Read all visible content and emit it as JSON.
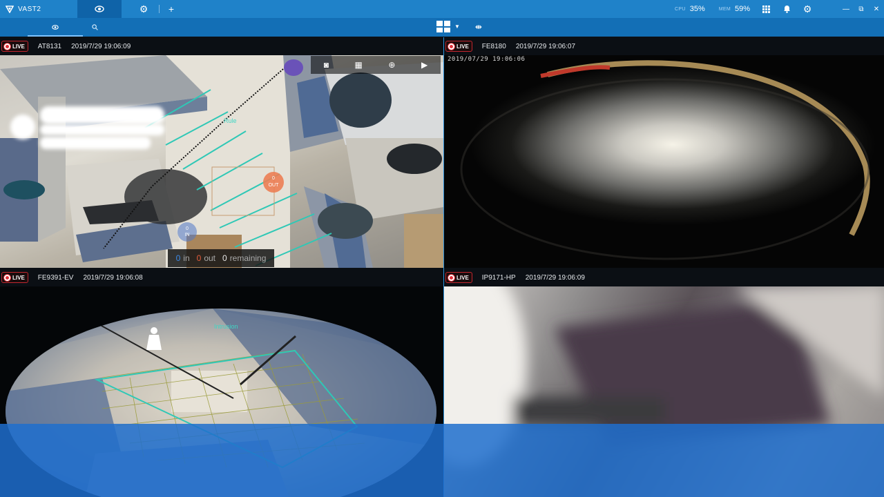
{
  "app": {
    "title": "VAST2"
  },
  "system": {
    "cpu_label": "CPU",
    "cpu_value": "35%",
    "mem_label": "MEM",
    "mem_value": "59%"
  },
  "icons": {
    "brand": "vast-logo-icon",
    "live_tab": "eye-icon",
    "settings": "gear-icon",
    "add": "plus-icon",
    "search": "search-icon",
    "layout": "grid-layout-icon",
    "sequence": "sequence-icon",
    "apps": "apps-grid-icon",
    "notifications": "bell-icon",
    "minimize": "minimize-icon",
    "restore": "restore-icon",
    "close": "close-icon",
    "snapshot": "camera-icon",
    "split": "layout-icon",
    "zoom": "zoom-icon",
    "play": "play-icon"
  },
  "cameras": [
    {
      "live": "LIVE",
      "name": "AT8131",
      "timestamp": "2019/7/29 19:06:09"
    },
    {
      "live": "LIVE",
      "name": "FE8180",
      "timestamp": "2019/7/29 19:06:07",
      "osd": "2019/07/29 19:06:06"
    },
    {
      "live": "LIVE",
      "name": "FE9391-EV",
      "timestamp": "2019/7/29 19:06:08",
      "rule": "Intrusion"
    },
    {
      "live": "LIVE",
      "name": "IP9171-HP",
      "timestamp": "2019/7/29 19:06:09"
    }
  ],
  "counting": {
    "in_value": "0",
    "in_label": "in",
    "out_value": "0",
    "out_label": "out",
    "remaining_value": "0",
    "remaining_label": "remaining",
    "out_badge_value": "0",
    "out_badge_label": "OUT",
    "in_badge_value": "0",
    "in_badge_label": "IN",
    "rule_label": "Rule"
  },
  "colors": {
    "accent": "#1f82c9",
    "toolbar": "#136fb6",
    "live": "#e02e37",
    "rule_line": "#3fd6c4"
  }
}
